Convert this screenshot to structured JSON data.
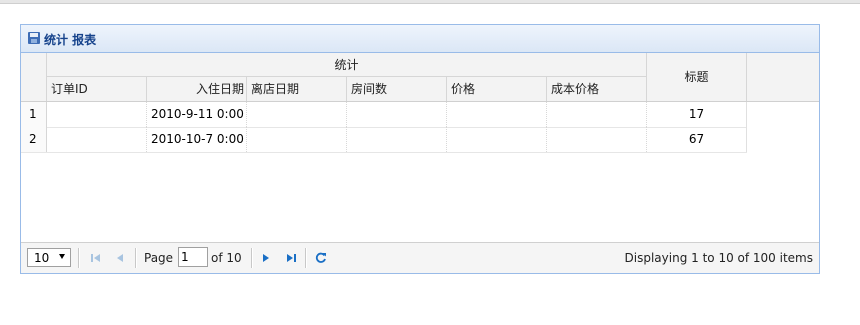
{
  "panel": {
    "title": "统计 报表"
  },
  "grid": {
    "group_header": "统计",
    "columns": [
      "订单ID",
      "入住日期",
      "离店日期",
      "房间数",
      "价格",
      "成本价格"
    ],
    "title_column": "标题",
    "rows": [
      {
        "num": "1",
        "order_id": "",
        "checkin": "2010-9-11 0:00",
        "checkout": "",
        "rooms": "",
        "price": "",
        "cost": "",
        "title": "17"
      },
      {
        "num": "2",
        "order_id": "",
        "checkin": "2010-10-7 0:00",
        "checkout": "",
        "rooms": "",
        "price": "",
        "cost": "",
        "title": "67"
      }
    ]
  },
  "pager": {
    "page_size": "10",
    "page_label": "Page",
    "current_page": "1",
    "of_label": "of 10",
    "display_info": "Displaying 1 to 10 of 100 items"
  },
  "icons": {
    "panel": "save-icon",
    "first": "first-page-icon",
    "prev": "prev-page-icon",
    "next": "next-page-icon",
    "last": "last-page-icon",
    "refresh": "refresh-icon"
  },
  "colors": {
    "border": "#99bbe8",
    "title": "#15428b",
    "pager_active": "#1a6fc5",
    "pager_disabled": "#a8c4e0"
  }
}
